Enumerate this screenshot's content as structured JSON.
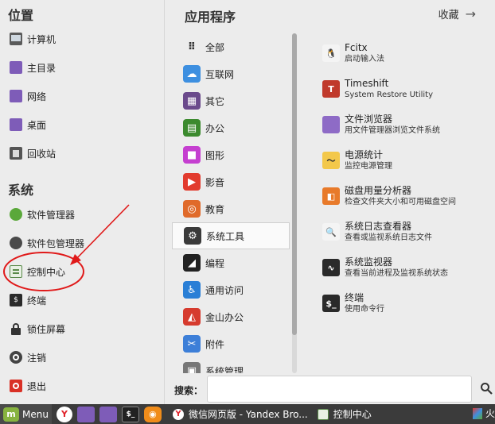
{
  "places": {
    "title": "位置",
    "items": [
      {
        "label": "计算机",
        "icon": "computer-icon"
      },
      {
        "label": "主目录",
        "icon": "home-folder-icon"
      },
      {
        "label": "网络",
        "icon": "network-folder-icon"
      },
      {
        "label": "桌面",
        "icon": "desktop-folder-icon"
      },
      {
        "label": "回收站",
        "icon": "trash-icon"
      }
    ]
  },
  "system": {
    "title": "系统",
    "items": [
      {
        "label": "软件管理器",
        "icon": "software-manager-icon"
      },
      {
        "label": "软件包管理器",
        "icon": "package-manager-icon"
      },
      {
        "label": "控制中心",
        "icon": "control-center-icon"
      },
      {
        "label": "终端",
        "icon": "terminal-icon"
      },
      {
        "label": "锁住屏幕",
        "icon": "lock-icon"
      },
      {
        "label": "注销",
        "icon": "logout-icon"
      },
      {
        "label": "退出",
        "icon": "power-icon"
      }
    ]
  },
  "applications": {
    "title": "应用程序",
    "categories": [
      {
        "label": "全部",
        "icon": "all-apps-icon",
        "color": "#ececec"
      },
      {
        "label": "互联网",
        "icon": "internet-cloud-icon",
        "color": "#3d8fe0"
      },
      {
        "label": "其它",
        "icon": "grid-icon",
        "color": "#6b4a8c"
      },
      {
        "label": "办公",
        "icon": "office-icon",
        "color": "#3b8a2e"
      },
      {
        "label": "图形",
        "icon": "graphics-icon",
        "color": "#c53fd0"
      },
      {
        "label": "影音",
        "icon": "play-icon",
        "color": "#e23b2e"
      },
      {
        "label": "教育",
        "icon": "education-icon",
        "color": "#e06a2a"
      },
      {
        "label": "系统工具",
        "icon": "gear-icon",
        "color": "#3a3a3a"
      },
      {
        "label": "编程",
        "icon": "programming-icon",
        "color": "#222222"
      },
      {
        "label": "通用访问",
        "icon": "accessibility-icon",
        "color": "#2a7fd6"
      },
      {
        "label": "金山办公",
        "icon": "wps-icon",
        "color": "#d63b2e"
      },
      {
        "label": "附件",
        "icon": "scissors-icon",
        "color": "#3d7fd8"
      },
      {
        "label": "系统管理",
        "icon": "admin-icon",
        "color": "#777777"
      }
    ],
    "active_index": 7
  },
  "favorites": {
    "label": "收藏"
  },
  "apps": [
    {
      "name": "Fcitx",
      "desc": "启动输入法",
      "icon": "penguin-icon",
      "color": "#f4f4f4"
    },
    {
      "name": "Timeshift",
      "desc": "System Restore Utility",
      "icon": "timeshift-icon",
      "color": "#c0392b"
    },
    {
      "name": "文件浏览器",
      "desc": "用文件管理器浏览文件系统",
      "icon": "folder-icon",
      "color": "#8e6bc6"
    },
    {
      "name": "电源统计",
      "desc": "监控电源管理",
      "icon": "power-statistics-icon",
      "color": "#f3c84a"
    },
    {
      "name": "磁盘用量分析器",
      "desc": "检查文件夹大小和可用磁盘空间",
      "icon": "disk-usage-icon",
      "color": "#e87a2a"
    },
    {
      "name": "系统日志查看器",
      "desc": "查看或监视系统日志文件",
      "icon": "log-viewer-icon",
      "color": "#f4f4f4"
    },
    {
      "name": "系统监视器",
      "desc": "查看当前进程及监视系统状态",
      "icon": "system-monitor-icon",
      "color": "#2a2a2a"
    },
    {
      "name": "终端",
      "desc": "使用命令行",
      "icon": "terminal-icon",
      "color": "#2a2a2a"
    }
  ],
  "search": {
    "label": "搜索：",
    "value": "",
    "placeholder": ""
  },
  "taskbar": {
    "menu_label": "Menu",
    "tasks": [
      {
        "label": "微信网页版 - Yandex Bro...",
        "icon": "yandex-icon"
      },
      {
        "label": "控制中心",
        "icon": "control-center-icon"
      }
    ],
    "end_label": "火"
  }
}
